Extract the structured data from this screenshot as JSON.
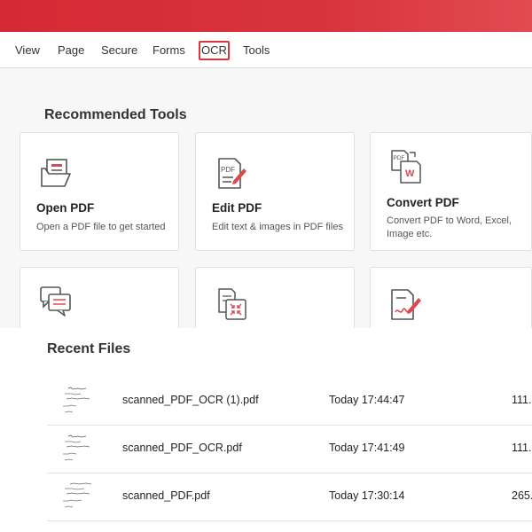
{
  "menubar": {
    "items": [
      {
        "label": "View"
      },
      {
        "label": "Page"
      },
      {
        "label": "Secure"
      },
      {
        "label": "Forms"
      },
      {
        "label": "OCR"
      },
      {
        "label": "Tools"
      }
    ],
    "active": "OCR"
  },
  "recommended": {
    "title": "Recommended Tools",
    "cards": [
      {
        "icon": "open-folder-icon",
        "title": "Open PDF",
        "desc": "Open a PDF file to get started"
      },
      {
        "icon": "edit-pdf-icon",
        "title": "Edit PDF",
        "desc": "Edit text & images in PDF files"
      },
      {
        "icon": "convert-pdf-icon",
        "title": "Convert PDF",
        "desc": "Convert PDF to Word, Excel, Image etc."
      },
      {
        "icon": "comment-icon",
        "title": "",
        "desc": ""
      },
      {
        "icon": "compress-icon",
        "title": "",
        "desc": ""
      },
      {
        "icon": "sign-icon",
        "title": "",
        "desc": ""
      }
    ],
    "pdf_badge": "PDF",
    "word_badge": "W"
  },
  "recent": {
    "title": "Recent Files",
    "files": [
      {
        "name": "scanned_PDF_OCR (1).pdf",
        "date": "Today 17:44:47",
        "size": "111."
      },
      {
        "name": "scanned_PDF_OCR.pdf",
        "date": "Today 17:41:49",
        "size": "111."
      },
      {
        "name": "scanned_PDF.pdf",
        "date": "Today 17:30:14",
        "size": "265."
      }
    ]
  },
  "colors": {
    "accent": "#d9363e",
    "titlebar": "#d8333d"
  }
}
